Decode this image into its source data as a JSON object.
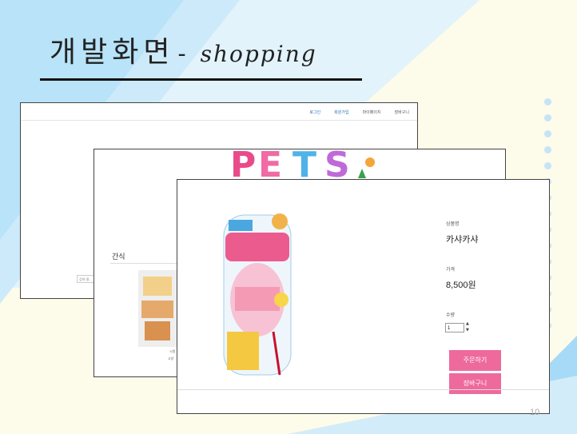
{
  "slide": {
    "title_korean": "개발화면",
    "title_dash": "-",
    "title_english": "shopping",
    "page_number": "10"
  },
  "window_home": {
    "nav": [
      "로그인",
      "회원가입",
      "마이페이지",
      "장바구니"
    ],
    "search_placeholder": "검색 결..."
  },
  "window_category": {
    "logo_text": "PETS",
    "category_title": "간식",
    "thumb_caption_line1": "시원",
    "thumb_caption_line2": "고양"
  },
  "window_detail": {
    "name_label": "상품명",
    "name_value": "카샤카샤",
    "price_label": "가격",
    "price_value": "8,500원",
    "qty_label": "수량",
    "qty_value": "1",
    "order_button": "주문하기",
    "cart_button": "장바구니"
  },
  "colors": {
    "accent_pink": "#ee6a9c",
    "link_blue": "#2c6fb6",
    "bg_light_blue": "#d6effc",
    "bg_blue": "#a7daf7"
  }
}
